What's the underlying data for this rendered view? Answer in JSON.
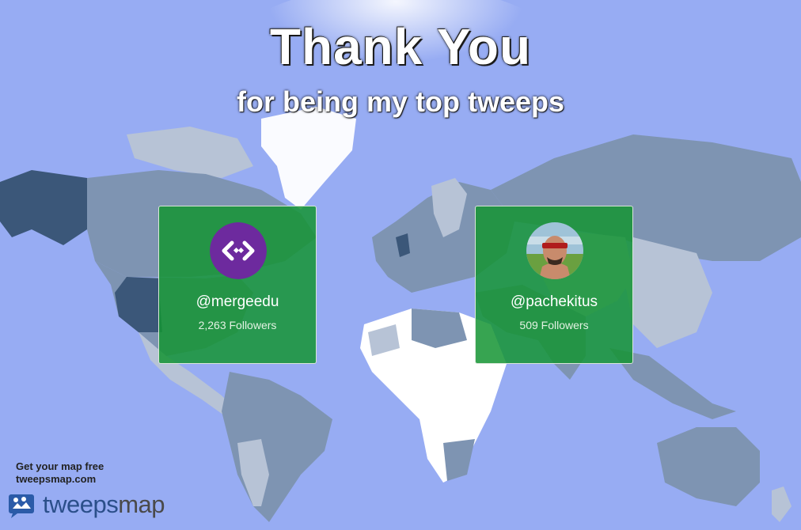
{
  "title": "Thank You",
  "subtitle": "for being my top tweeps",
  "cards": [
    {
      "handle": "@mergeedu",
      "followers": "2,263 Followers",
      "avatar_icon": "merge-logo-icon"
    },
    {
      "handle": "@pachekitus",
      "followers": "509 Followers",
      "avatar_icon": "user-photo-icon"
    }
  ],
  "promo": {
    "line1": "Get your map free",
    "line2": "tweepsmap.com"
  },
  "brand": {
    "part1": "tweeps",
    "part2": "map"
  },
  "colors": {
    "ocean": "#97acf3",
    "card": "#149432",
    "land_dark": "#3b5779",
    "land_mid": "#7e94b2",
    "land_light": "#b7c3d6"
  }
}
